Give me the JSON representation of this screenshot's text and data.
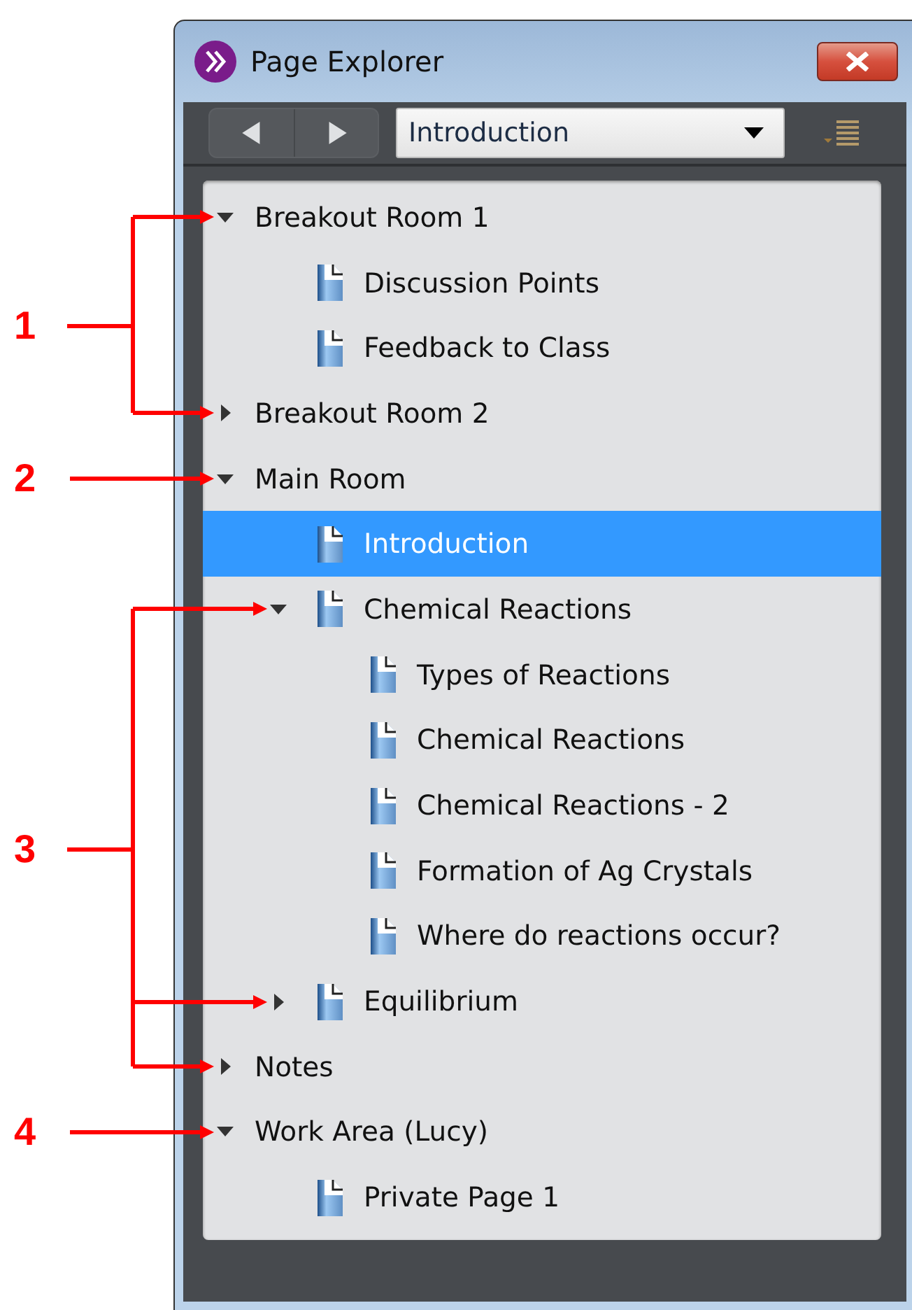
{
  "window": {
    "title": "Page Explorer"
  },
  "toolbar": {
    "page_select": {
      "value": "Introduction"
    }
  },
  "tree": [
    {
      "label": "Breakout Room 1",
      "kind": "group",
      "expanded": true,
      "selected": false,
      "children": [
        {
          "label": "Discussion Points",
          "kind": "page",
          "selected": false
        },
        {
          "label": "Feedback to Class",
          "kind": "page",
          "selected": false
        }
      ]
    },
    {
      "label": "Breakout Room 2",
      "kind": "group",
      "expanded": false,
      "selected": false
    },
    {
      "label": "Main Room",
      "kind": "group",
      "expanded": true,
      "selected": false,
      "children": [
        {
          "label": "Introduction",
          "kind": "page",
          "selected": true
        },
        {
          "label": "Chemical Reactions",
          "kind": "page",
          "expanded": true,
          "selected": false,
          "children": [
            {
              "label": "Types of Reactions",
              "kind": "page",
              "selected": false
            },
            {
              "label": "Chemical Reactions",
              "kind": "page",
              "selected": false
            },
            {
              "label": "Chemical Reactions -  2",
              "kind": "page",
              "selected": false
            },
            {
              "label": "Formation of Ag Crystals",
              "kind": "page",
              "selected": false
            },
            {
              "label": "Where do reactions occur?",
              "kind": "page",
              "selected": false
            }
          ]
        },
        {
          "label": "Equilibrium",
          "kind": "page",
          "expanded": false,
          "selected": false
        }
      ]
    },
    {
      "label": "Notes",
      "kind": "group",
      "expanded": false,
      "selected": false
    },
    {
      "label": "Work Area (Lucy)",
      "kind": "group",
      "expanded": true,
      "selected": false,
      "children": [
        {
          "label": "Private Page 1",
          "kind": "page",
          "selected": false
        }
      ]
    }
  ],
  "callouts": [
    {
      "label": "1"
    },
    {
      "label": "2"
    },
    {
      "label": "3"
    },
    {
      "label": "4"
    }
  ]
}
